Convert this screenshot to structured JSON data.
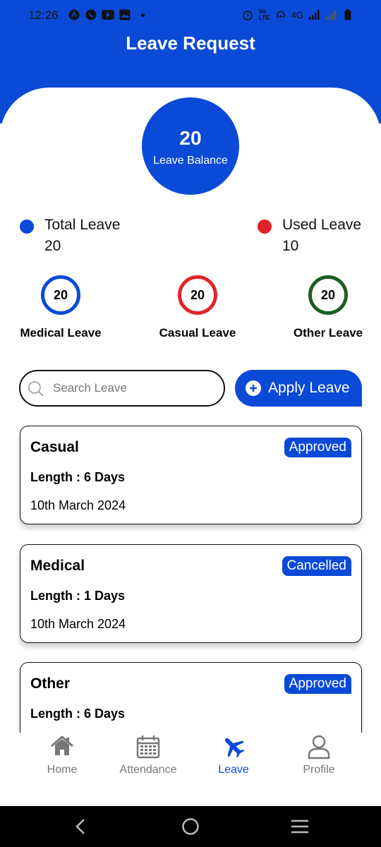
{
  "status_bar": {
    "time": "12:26",
    "network": "4G"
  },
  "header": {
    "title": "Leave Request"
  },
  "balance": {
    "value": "20",
    "label": "Leave Balance"
  },
  "totals": {
    "total": {
      "label": "Total Leave",
      "value": "20",
      "color": "#0a4ad6"
    },
    "used": {
      "label": "Used Leave",
      "value": "10",
      "color": "#e0232a"
    }
  },
  "leave_types": [
    {
      "label": "Medical Leave",
      "value": "20",
      "color": "#0a4ad6"
    },
    {
      "label": "Casual Leave",
      "value": "20",
      "color": "#e0232a"
    },
    {
      "label": "Other Leave",
      "value": "20",
      "color": "#1b5e20"
    }
  ],
  "search": {
    "placeholder": "Search Leave"
  },
  "apply_button": {
    "label": "Apply Leave"
  },
  "requests": [
    {
      "type": "Casual",
      "length": "Length : 6 Days",
      "date": "10th March 2024",
      "status": "Approved"
    },
    {
      "type": "Medical",
      "length": "Length : 1 Days",
      "date": "10th March 2024",
      "status": "Cancelled"
    },
    {
      "type": "Other",
      "length": "Length : 6 Days",
      "date": "",
      "status": "Approved"
    }
  ],
  "bottom_nav": [
    {
      "label": "Home",
      "icon": "home-icon",
      "active": false
    },
    {
      "label": "Attendance",
      "icon": "calendar-icon",
      "active": false
    },
    {
      "label": "Leave",
      "icon": "airplane-icon",
      "active": true
    },
    {
      "label": "Profile",
      "icon": "profile-icon",
      "active": false
    }
  ],
  "colors": {
    "primary": "#0a4ad6",
    "danger": "#e0232a",
    "success": "#1b5e20",
    "inactive": "#777777"
  }
}
